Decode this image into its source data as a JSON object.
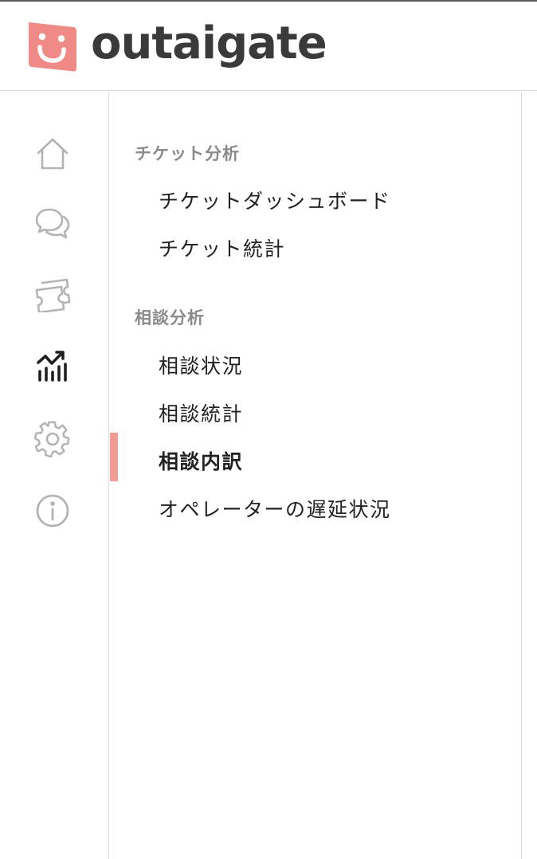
{
  "brand": {
    "name": "outaigate",
    "color": "#f08a86",
    "text_color": "#3a3a3a"
  },
  "rail": {
    "items": [
      {
        "icon": "home-icon"
      },
      {
        "icon": "chat-bubbles-icon"
      },
      {
        "icon": "tickets-icon"
      },
      {
        "icon": "analytics-chart-icon",
        "active": true
      },
      {
        "icon": "gear-icon"
      },
      {
        "icon": "info-icon"
      }
    ]
  },
  "menu": {
    "sections": [
      {
        "title": "チケット分析",
        "items": [
          {
            "label": "チケットダッシュボード"
          },
          {
            "label": "チケット統計"
          }
        ]
      },
      {
        "title": "相談分析",
        "items": [
          {
            "label": "相談状況"
          },
          {
            "label": "相談統計"
          },
          {
            "label": "相談内訳",
            "active": true
          },
          {
            "label": "オペレーターの遅延状況"
          }
        ]
      }
    ],
    "active_indicator_color": "#f29a96"
  }
}
